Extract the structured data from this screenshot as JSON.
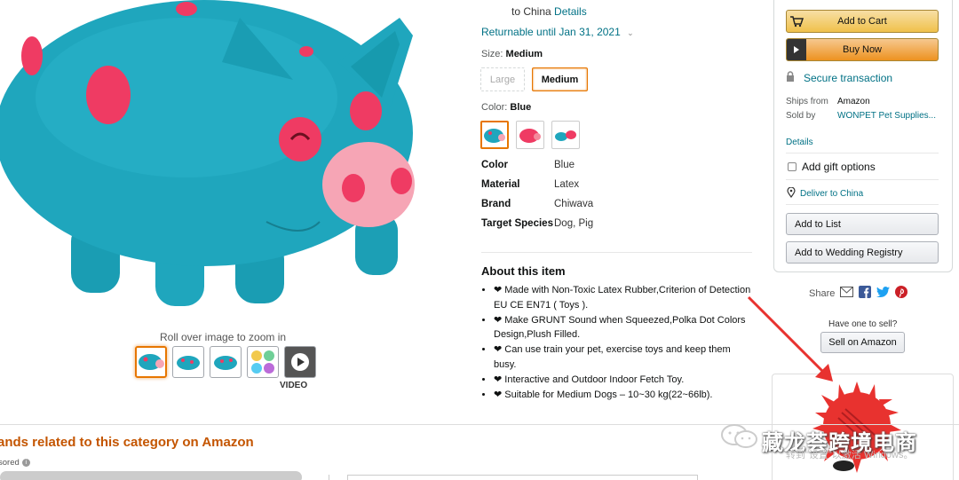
{
  "gallery": {
    "zoom_hint": "Roll over image to zoom in",
    "video_label": "VIDEO",
    "thumbnails": [
      "blue-pig-front",
      "blue-pig-side",
      "blue-pig-back",
      "multi-toys",
      "video"
    ]
  },
  "shipping": {
    "ships_to_prefix": "to China",
    "ships_to_link": "Details",
    "returnable": "Returnable until Jan 31, 2021"
  },
  "size": {
    "label": "Size:",
    "selected": "Medium",
    "options": [
      "Large",
      "Medium"
    ]
  },
  "color": {
    "label": "Color:",
    "selected": "Blue",
    "swatches": [
      "blue",
      "pink",
      "blue-red"
    ]
  },
  "specs": [
    {
      "key": "Color",
      "value": "Blue"
    },
    {
      "key": "Material",
      "value": "Latex"
    },
    {
      "key": "Brand",
      "value": "Chiwava"
    },
    {
      "key": "Target Species",
      "value": "Dog, Pig"
    }
  ],
  "about": {
    "title": "About this item",
    "bullets": [
      "❤ Made with Non-Toxic Latex Rubber,Criterion of Detection EU CE EN71 ( Toys ).",
      "❤ Make GRUNT Sound when Squeezed,Polka Dot Colors Design,Plush Filled.",
      "❤ Can use train your pet, exercise toys and keep them busy.",
      "❤ Interactive and Outdoor Indoor Fetch Toy.",
      "❤ Suitable for Medium Dogs – 10~30 kg(22~66lb)."
    ]
  },
  "buybox": {
    "add_to_cart": "Add to Cart",
    "buy_now": "Buy Now",
    "secure": "Secure transaction",
    "ships_from_label": "Ships from",
    "ships_from_value": "Amazon",
    "sold_by_label": "Sold by",
    "sold_by_value": "WONPET Pet Supplies...",
    "details": "Details",
    "gift": "Add gift options",
    "deliver": "Deliver to China",
    "add_to_list": "Add to List",
    "add_to_registry": "Add to Wedding Registry"
  },
  "share": {
    "label": "Share"
  },
  "sell": {
    "question": "Have one to sell?",
    "button": "Sell on Amazon"
  },
  "bottom": {
    "brands_title": "ands related to this category on Amazon",
    "sponsored": "sored"
  },
  "watermark": {
    "title": "藏龙荟跨境电商",
    "subtitle": "转到\"设置\"以激活 Windows。"
  },
  "colors": {
    "link": "#007185",
    "cart_yellow": "#f0c14b",
    "buy_orange": "#ed9220",
    "brands_orange": "#c45500",
    "arrow_red": "#e8322f",
    "pig_teal": "#1fa6bd",
    "pig_dot": "#ef3b63"
  }
}
